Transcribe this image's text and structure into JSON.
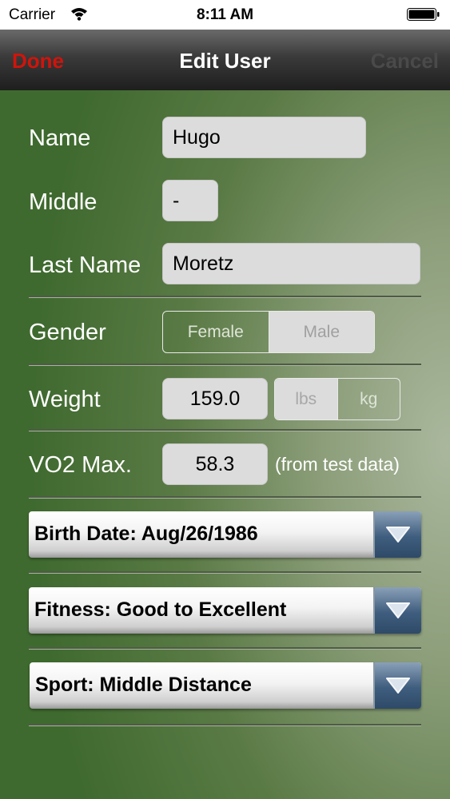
{
  "status_bar": {
    "carrier": "Carrier",
    "time": "8:11 AM"
  },
  "nav": {
    "done": "Done",
    "title": "Edit User",
    "cancel": "Cancel"
  },
  "form": {
    "name_label": "Name",
    "name_value": "Hugo",
    "middle_label": "Middle",
    "middle_value": "-",
    "last_name_label": "Last Name",
    "last_name_value": "Moretz",
    "gender_label": "Gender",
    "gender_options": [
      "Female",
      "Male"
    ],
    "gender_selected": "Male",
    "weight_label": "Weight",
    "weight_value": "159.0",
    "weight_units": [
      "lbs",
      "kg"
    ],
    "weight_unit_selected": "kg",
    "vo2_label": "VO2 Max.",
    "vo2_value": "58.3",
    "vo2_note": "(from test data)",
    "birth_date": "Birth Date: Aug/26/1986",
    "fitness": "Fitness: Good to Excellent",
    "sport": "Sport: Middle Distance"
  },
  "colors": {
    "done": "#d0140c",
    "dropdown_button": "#3f5d7e"
  },
  "icons": [
    "wifi-icon",
    "battery-icon",
    "chevron-down-icon"
  ]
}
